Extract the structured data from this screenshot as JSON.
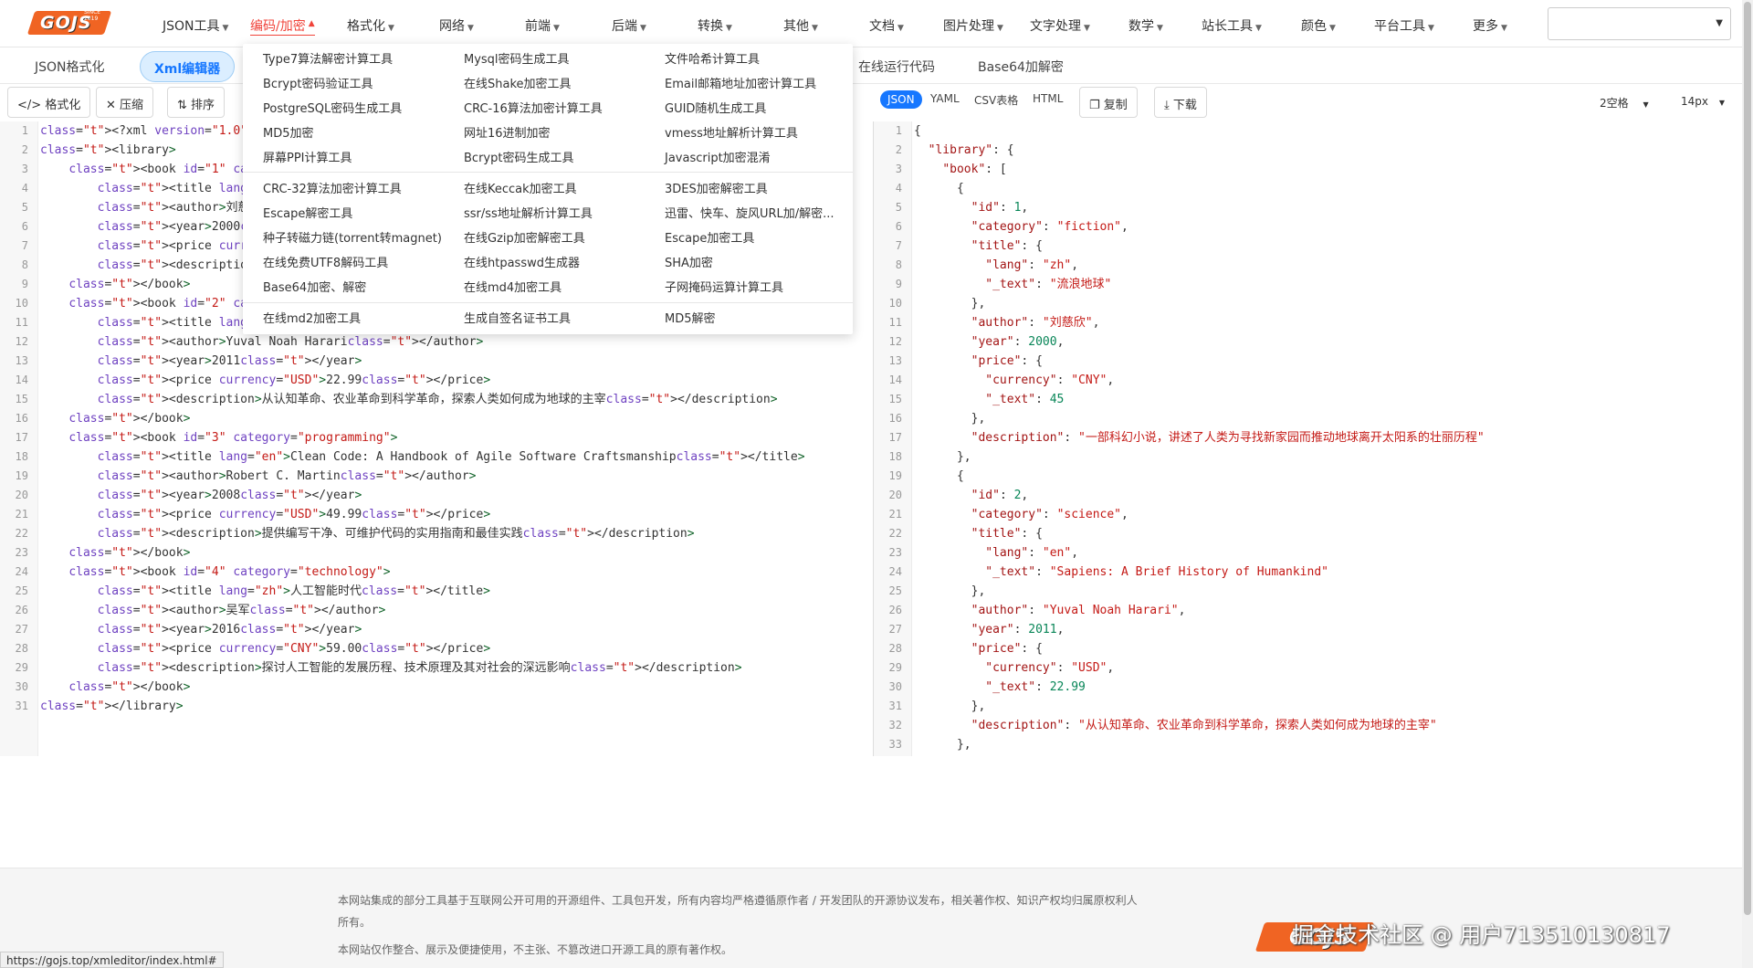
{
  "logo": {
    "text": "GOJS",
    "since": "SINCE 2019"
  },
  "nav": [
    {
      "label": "JSON工具"
    },
    {
      "label": "编码/加密"
    },
    {
      "label": "格式化"
    },
    {
      "label": "网络"
    },
    {
      "label": "前端"
    },
    {
      "label": "后端"
    },
    {
      "label": "转换"
    },
    {
      "label": "其他"
    },
    {
      "label": "文档"
    },
    {
      "label": "图片处理"
    },
    {
      "label": "文字处理"
    },
    {
      "label": "数学"
    },
    {
      "label": "站长工具"
    },
    {
      "label": "颜色"
    },
    {
      "label": "平台工具"
    },
    {
      "label": "更多"
    }
  ],
  "subtabs": [
    "JSON格式化",
    "Xml编辑器",
    "在线运行代码",
    "Base64加解密"
  ],
  "toolbar": {
    "format": "格式化",
    "compress": "压缩",
    "sort": "排序",
    "copy": "复制",
    "download": "下载",
    "indent": "2空格",
    "fontsize": "14px"
  },
  "formats": [
    "JSON",
    "YAML",
    "CSV表格",
    "HTML"
  ],
  "dropdown": {
    "col1": [
      "Type7算法解密计算工具",
      "Bcrypt密码验证工具",
      "PostgreSQL密码生成工具",
      "MD5加密",
      "屏幕PPI计算工具",
      "CRC-32算法加密计算工具",
      "Escape解密工具",
      "种子转磁力链(torrent转magnet)",
      "在线免费UTF8解码工具",
      "Base64加密、解密",
      "在线md2加密工具"
    ],
    "col2": [
      "Mysql密码生成工具",
      "在线Shake加密工具",
      "CRC-16算法加密计算工具",
      "网址16进制加密",
      "Bcrypt密码生成工具",
      "在线Keccak加密工具",
      "ssr/ss地址解析计算工具",
      "在线Gzip加密解密工具",
      "在线htpasswd生成器",
      "在线md4加密工具",
      "生成自签名证书工具"
    ],
    "col3": [
      "文件哈希计算工具",
      "Email邮箱地址加密计算工具",
      "GUID随机生成工具",
      "vmess地址解析计算工具",
      "Javascript加密混淆",
      "3DES加密解密工具",
      "迅雷、快车、旋风URL加/解密...",
      "Escape加密工具",
      "SHA加密",
      "子网掩码运算计算工具",
      "MD5解密"
    ]
  },
  "xml_lines": [
    "<?xml version=\"1.0\" encoding=\"UTF-8\"?>",
    "<library>",
    "    <book id=\"1\" category=\"fiction\">",
    "        <title lang=\"zh\">流浪地球</title>",
    "        <author>刘慈欣</author>",
    "        <year>2000</year>",
    "        <price currency=\"CNY\">45</price>",
    "        <description>一部科幻小说</description>",
    "    </book>",
    "    <book id=\"2\" category=\"science\">",
    "        <title lang=\"en\">Sapiens: A Brief History of Humankind</title>",
    "        <author>Yuval Noah Harari</author>",
    "        <year>2011</year>",
    "        <price currency=\"USD\">22.99</price>",
    "        <description>从认知革命、农业革命到科学革命，探索人类如何成为地球的主宰</description>",
    "    </book>",
    "    <book id=\"3\" category=\"programming\">",
    "        <title lang=\"en\">Clean Code: A Handbook of Agile Software Craftsmanship</title>",
    "        <author>Robert C. Martin</author>",
    "        <year>2008</year>",
    "        <price currency=\"USD\">49.99</price>",
    "        <description>提供编写干净、可维护代码的实用指南和最佳实践</description>",
    "    </book>",
    "    <book id=\"4\" category=\"technology\">",
    "        <title lang=\"zh\">人工智能时代</title>",
    "        <author>吴军</author>",
    "        <year>2016</year>",
    "        <price currency=\"CNY\">59.00</price>",
    "        <description>探讨人工智能的发展历程、技术原理及其对社会的深远影响</description>",
    "    </book>",
    "</library>"
  ],
  "json_lines": [
    "{",
    "  \"library\": {",
    "    \"book\": [",
    "      {",
    "        \"id\": 1,",
    "        \"category\": \"fiction\",",
    "        \"title\": {",
    "          \"lang\": \"zh\",",
    "          \"_text\": \"流浪地球\"",
    "        },",
    "        \"author\": \"刘慈欣\",",
    "        \"year\": 2000,",
    "        \"price\": {",
    "          \"currency\": \"CNY\",",
    "          \"_text\": 45",
    "        },",
    "        \"description\": \"一部科幻小说，讲述了人类为寻找新家园而推动地球离开太阳系的壮丽历程\"",
    "      },",
    "      {",
    "        \"id\": 2,",
    "        \"category\": \"science\",",
    "        \"title\": {",
    "          \"lang\": \"en\",",
    "          \"_text\": \"Sapiens: A Brief History of Humankind\"",
    "        },",
    "        \"author\": \"Yuval Noah Harari\",",
    "        \"year\": 2011,",
    "        \"price\": {",
    "          \"currency\": \"USD\",",
    "          \"_text\": 22.99",
    "        },",
    "        \"description\": \"从认知革命、农业革命到科学革命，探索人类如何成为地球的主宰\"",
    "      },"
  ],
  "footer": {
    "line1": "本网站集成的部分工具基于互联网公开可用的开源组件、工具包开发，所有内容均严格遵循原作者 / 开发团队的开源协议发布，相关著作权、知识产权均归属原权利人",
    "line2": "所有。",
    "line3": "本网站仅作整合、展示及便捷使用，不主张、不篡改进口开源工具的原有著作权。"
  },
  "watermark": "掘金技术社区 @ 用户713510130817",
  "status_url": "https://gojs.top/xmleditor/index.html#"
}
